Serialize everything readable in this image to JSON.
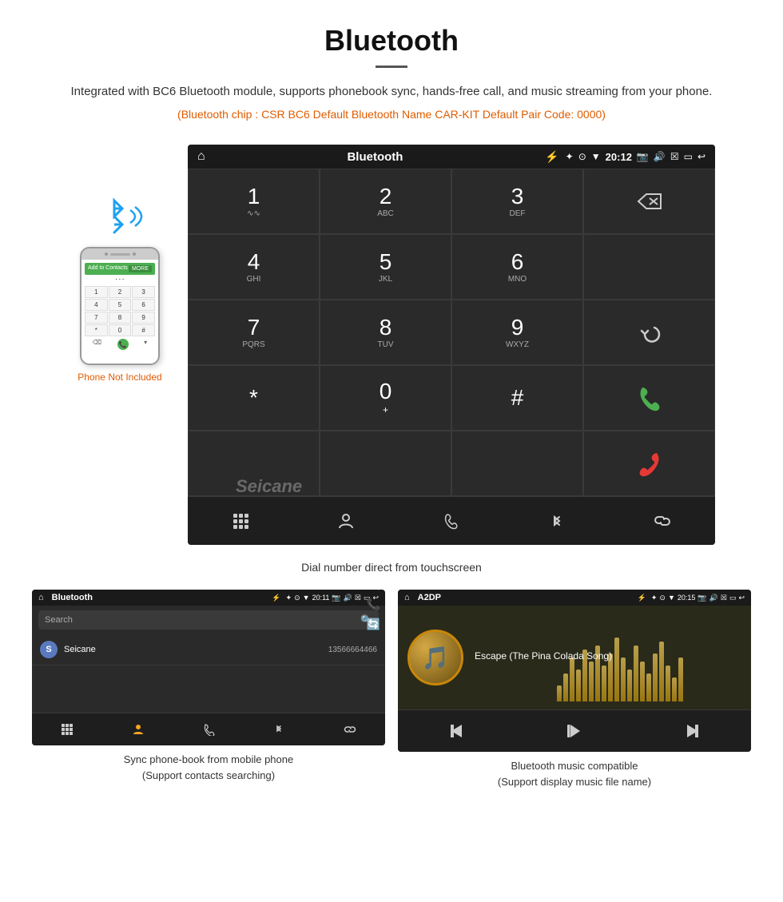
{
  "header": {
    "title": "Bluetooth",
    "description": "Integrated with BC6 Bluetooth module, supports phonebook sync, hands-free call, and music streaming from your phone.",
    "specs": "(Bluetooth chip : CSR BC6    Default Bluetooth Name CAR-KIT    Default Pair Code: 0000)"
  },
  "phone_label": "Phone Not Included",
  "dial_screen": {
    "status_bar": {
      "title": "Bluetooth",
      "usb_icon": "⚡",
      "time": "20:12",
      "icons": "✦ ⊙ ▼ 📷 🔊 ☒ ▭ ↩"
    },
    "keys": [
      {
        "num": "1",
        "sub": "∿∿",
        "row": 0,
        "col": 0
      },
      {
        "num": "2",
        "sub": "ABC",
        "row": 0,
        "col": 1
      },
      {
        "num": "3",
        "sub": "DEF",
        "row": 0,
        "col": 2
      },
      {
        "num": "4",
        "sub": "GHI",
        "row": 1,
        "col": 0
      },
      {
        "num": "5",
        "sub": "JKL",
        "row": 1,
        "col": 1
      },
      {
        "num": "6",
        "sub": "MNO",
        "row": 1,
        "col": 2
      },
      {
        "num": "7",
        "sub": "PQRS",
        "row": 2,
        "col": 0
      },
      {
        "num": "8",
        "sub": "TUV",
        "row": 2,
        "col": 1
      },
      {
        "num": "9",
        "sub": "WXYZ",
        "row": 2,
        "col": 2
      },
      {
        "num": "*",
        "sub": "",
        "row": 3,
        "col": 0
      },
      {
        "num": "0",
        "sub": "+",
        "row": 3,
        "col": 1
      },
      {
        "num": "#",
        "sub": "",
        "row": 3,
        "col": 2
      }
    ],
    "bottom_icons": [
      "⣿",
      "👤",
      "📞",
      "✦",
      "🔗"
    ]
  },
  "dial_caption": "Dial number direct from touchscreen",
  "phonebook_screen": {
    "status_bar": {
      "home": "⌂",
      "title": "Bluetooth",
      "usb": "⚡",
      "time": "20:11",
      "icons": "✦ ⊙ ▼ 📷 🔊 ☒ ▭ ↩"
    },
    "search_placeholder": "Search",
    "contact": {
      "letter": "S",
      "name": "Seicane",
      "number": "13566664466"
    },
    "bottom_icons": [
      "⣿",
      "👤",
      "📞",
      "✦",
      "🔗"
    ]
  },
  "music_screen": {
    "status_bar": {
      "home": "⌂",
      "title": "A2DP",
      "usb": "⚡",
      "time": "20:15",
      "icons": "✦ ⊙ ▼ 📷 🔊 ☒ ▭ ↩"
    },
    "song_title": "Escape (The Pina Colada Song)",
    "controls": [
      "⏮",
      "⏯",
      "⏭"
    ]
  },
  "phonebook_caption_line1": "Sync phone-book from mobile phone",
  "phonebook_caption_line2": "(Support contacts searching)",
  "music_caption_line1": "Bluetooth music compatible",
  "music_caption_line2": "(Support display music file name)",
  "watermark": "Seicane"
}
